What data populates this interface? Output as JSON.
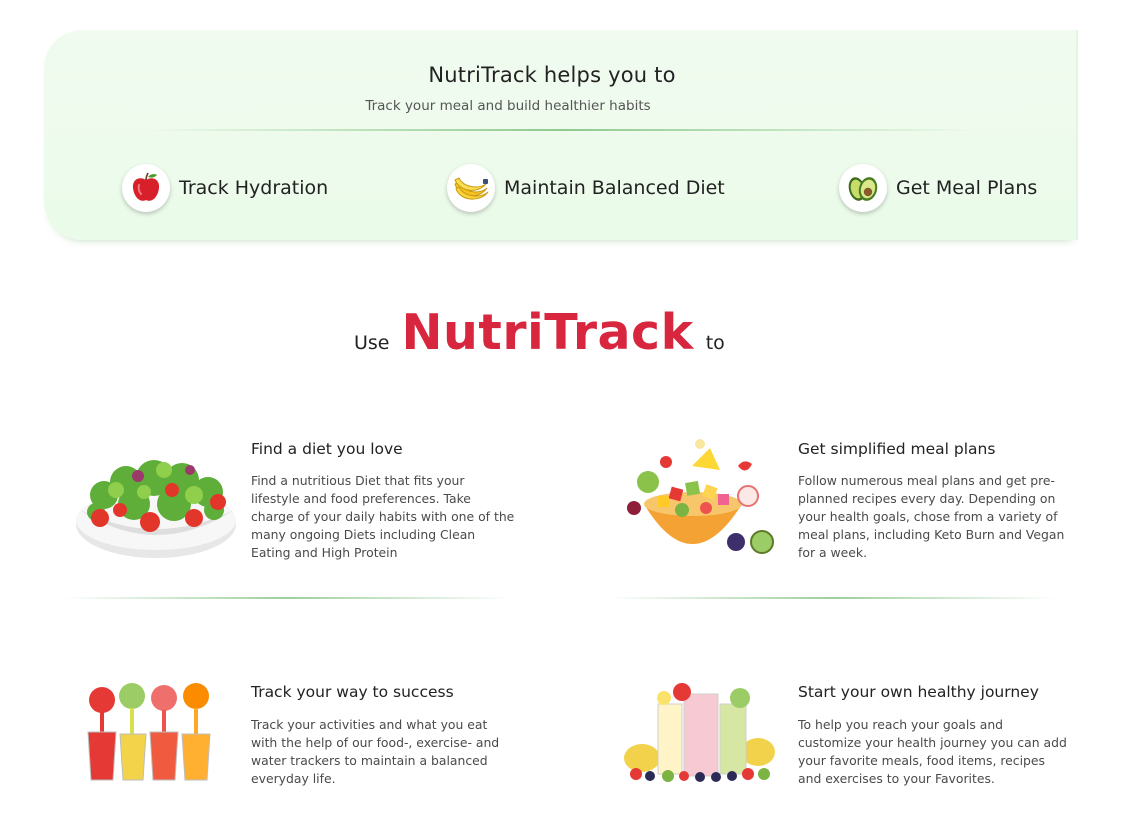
{
  "intro": {
    "title": "NutriTrack helps you to",
    "subtitle": "Track your meal and build healthier habits",
    "features": [
      {
        "label": "Track Hydration",
        "icon": "apple-icon"
      },
      {
        "label": "Maintain Balanced Diet",
        "icon": "banana-icon"
      },
      {
        "label": "Get Meal Plans",
        "icon": "avocado-icon"
      }
    ]
  },
  "headline": {
    "prefix": "Use",
    "brand": "NutriTrack",
    "suffix": "to",
    "brand_color": "#d7263d"
  },
  "benefits": [
    {
      "title": "Find a diet you love",
      "text": "Find a nutritious Diet that fits your lifestyle and food preferences. Take charge of your daily habits with one of the many ongoing Diets including Clean Eating and High Protein",
      "image": "salad-bowl-image"
    },
    {
      "title": "Get simplified meal plans",
      "text": "Follow numerous  meal plans and get pre-planned recipes every day. Depending on your health goals, chose from a variety of meal plans, including Keto Burn and Vegan for a week.",
      "image": "fruit-bowl-image"
    },
    {
      "title": "Track your way to success",
      "text": "Track your activities and what you eat with the help of our food-, exercise- and water trackers to maintain a balanced everyday life.",
      "image": "fruit-juices-image"
    },
    {
      "title": "Start your own healthy journey",
      "text": "To help you reach your goals and customize your health journey you can add your favorite meals, food items, recipes and exercises to your Favorites.",
      "image": "smoothies-image"
    }
  ]
}
